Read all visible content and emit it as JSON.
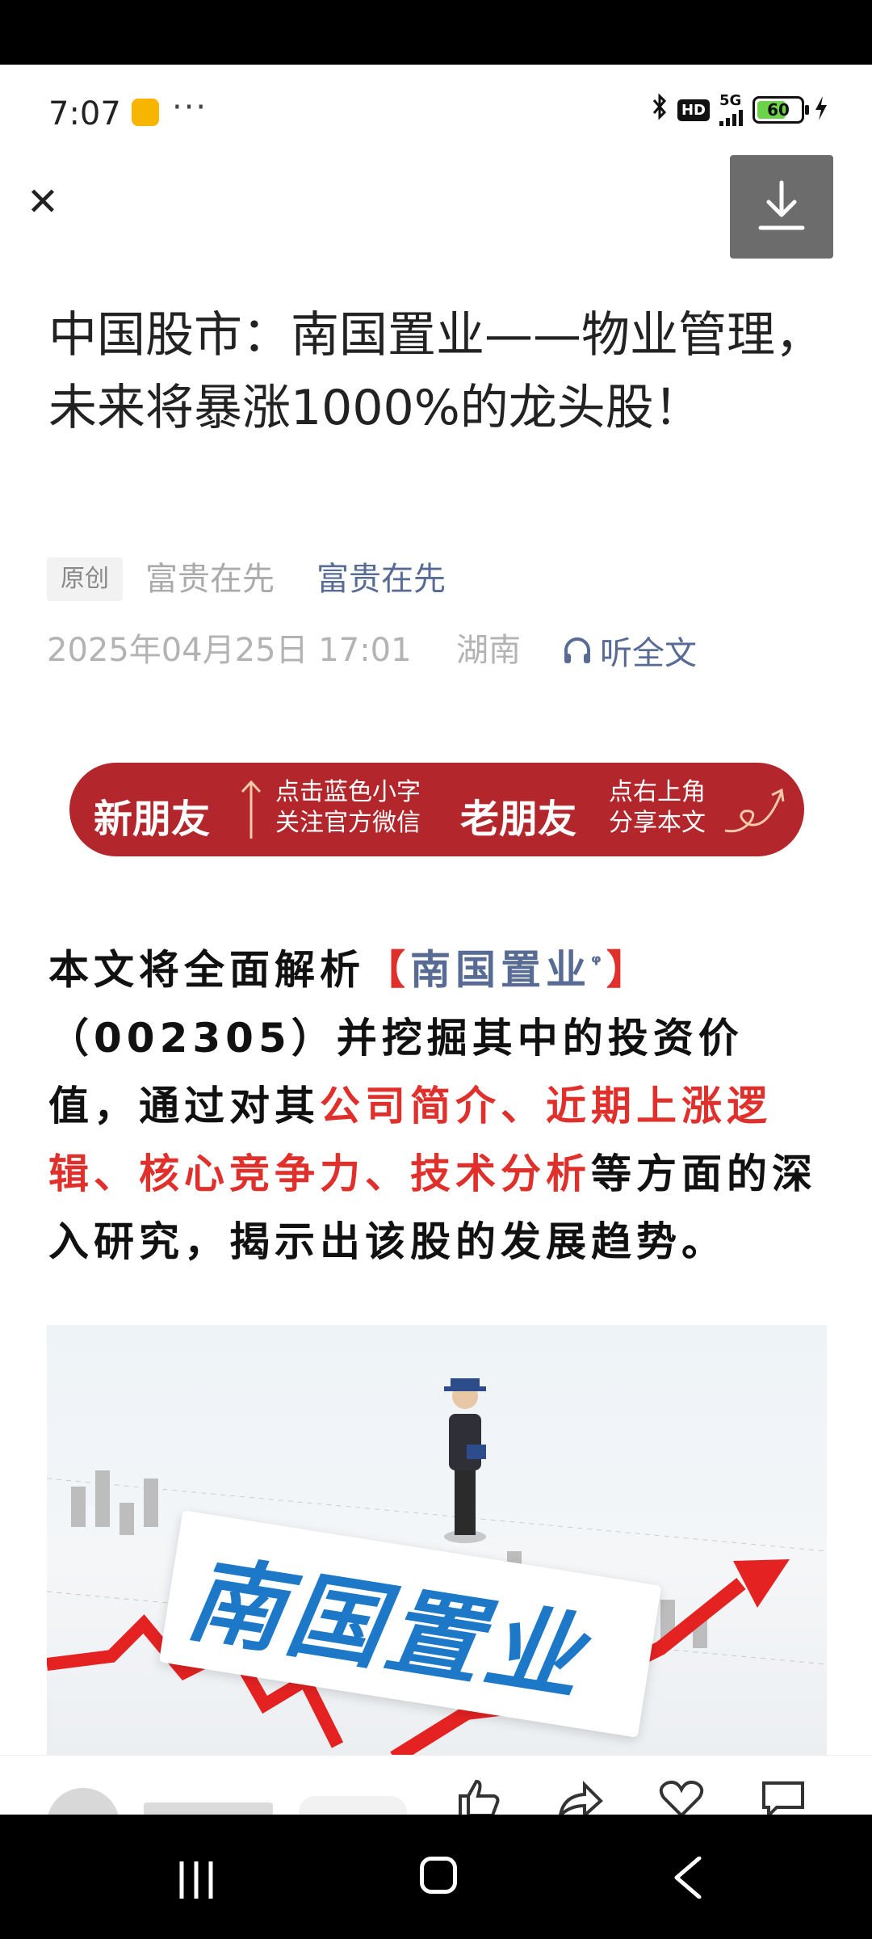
{
  "status_bar": {
    "time": "7:07",
    "more": "···",
    "network": "5G",
    "hd": "HD",
    "battery": "60"
  },
  "toolbar": {
    "close": "✕"
  },
  "article": {
    "title": "中国股市：南国置业——物业管理，未来将暴涨1000%的龙头股！",
    "original_badge": "原创",
    "author_name": "富贵在先",
    "account_name": "富贵在先",
    "datetime": "2025年04月25日 17:01",
    "location": "湖南",
    "listen_label": "听全文"
  },
  "banner": {
    "new_friend": "新朋友",
    "new_friend_tip_line1": "点击蓝色小字",
    "new_friend_tip_line2": "关注官方微信",
    "old_friend": "老朋友",
    "old_friend_tip_line1": "点右上角",
    "old_friend_tip_line2": "分享本文"
  },
  "body": {
    "p1_a": "本文将全面解析",
    "bracket_open": "【",
    "stock_name": "南国置业",
    "search_icon": "ᵠ",
    "bracket_close": "】",
    "p1_b": "（002305）并挖掘其中的投资价值，通过对其",
    "highlight": "公司简介、近期上涨逻辑、核心竞争力、技术分析",
    "p1_c": "等方面的深入研究，揭示出该股的发展趋势。"
  },
  "hero_image": {
    "text": "南国置业"
  },
  "colors": {
    "link": "#576b95",
    "highlight": "#e0302c",
    "banner": "#b3262b"
  }
}
